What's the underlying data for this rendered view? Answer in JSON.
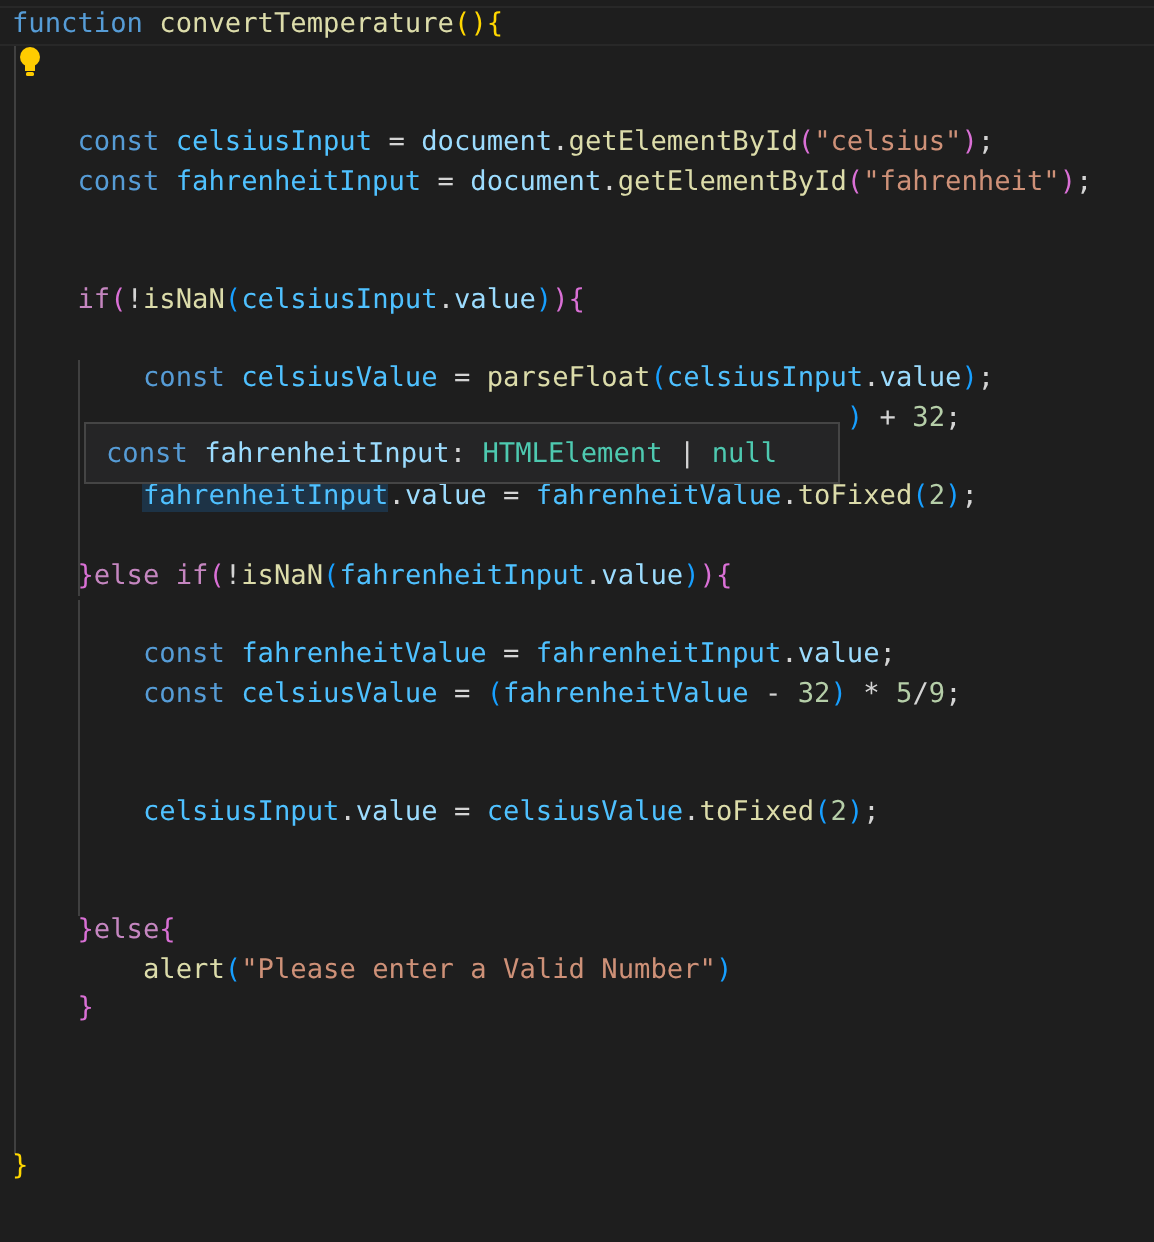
{
  "code_action_lightbulb": true,
  "tooltip": [
    {
      "text": "const ",
      "kind": "keyword"
    },
    {
      "text": "fahrenheitInput",
      "kind": "variable"
    },
    {
      "text": ": ",
      "kind": "plain"
    },
    {
      "text": "HTMLElement",
      "kind": "type"
    },
    {
      "text": " | ",
      "kind": "plain"
    },
    {
      "text": "null",
      "kind": "type"
    }
  ],
  "lines": [
    {
      "current": true,
      "tokens": [
        {
          "text": "function ",
          "kind": "keyword"
        },
        {
          "text": "convertTemperature",
          "kind": "function"
        },
        {
          "text": "(",
          "kind": "bracket1"
        },
        {
          "text": ")",
          "kind": "bracket1"
        },
        {
          "text": "{",
          "kind": "bracket1"
        }
      ]
    },
    {
      "current": false
    },
    {
      "current": false
    },
    {
      "current": false,
      "tokens": [
        {
          "text": "    const ",
          "kind": "keyword"
        },
        {
          "text": "celsiusInput",
          "kind": "constant"
        },
        {
          "text": " = ",
          "kind": "plain"
        },
        {
          "text": "document",
          "kind": "variable"
        },
        {
          "text": ".",
          "kind": "plain"
        },
        {
          "text": "getElementById",
          "kind": "function"
        },
        {
          "text": "(",
          "kind": "bracket2"
        },
        {
          "text": "\"celsius\"",
          "kind": "string"
        },
        {
          "text": ")",
          "kind": "bracket2"
        },
        {
          "text": ";",
          "kind": "plain"
        }
      ]
    },
    {
      "current": false,
      "tokens": [
        {
          "text": "    const ",
          "kind": "keyword"
        },
        {
          "text": "fahrenheitInput",
          "kind": "constant"
        },
        {
          "text": " = ",
          "kind": "plain"
        },
        {
          "text": "document",
          "kind": "variable"
        },
        {
          "text": ".",
          "kind": "plain"
        },
        {
          "text": "getElementById",
          "kind": "function"
        },
        {
          "text": "(",
          "kind": "bracket2"
        },
        {
          "text": "\"fahrenheit\"",
          "kind": "string"
        },
        {
          "text": ")",
          "kind": "bracket2"
        },
        {
          "text": ";",
          "kind": "plain"
        }
      ]
    },
    {
      "current": false
    },
    {
      "current": false
    },
    {
      "current": false,
      "tokens": [
        {
          "text": "    if",
          "kind": "control"
        },
        {
          "text": "(",
          "kind": "bracket2"
        },
        {
          "text": "!",
          "kind": "plain"
        },
        {
          "text": "isNaN",
          "kind": "function"
        },
        {
          "text": "(",
          "kind": "bracket3"
        },
        {
          "text": "celsiusInput",
          "kind": "constant"
        },
        {
          "text": ".",
          "kind": "plain"
        },
        {
          "text": "value",
          "kind": "variable"
        },
        {
          "text": ")",
          "kind": "bracket3"
        },
        {
          "text": ")",
          "kind": "bracket2"
        },
        {
          "text": "{",
          "kind": "bracket2"
        }
      ]
    },
    {
      "current": false
    },
    {
      "current": false,
      "tokens": [
        {
          "text": "        const ",
          "kind": "keyword"
        },
        {
          "text": "celsiusValue",
          "kind": "constant"
        },
        {
          "text": " = ",
          "kind": "plain"
        },
        {
          "text": "parseFloat",
          "kind": "function"
        },
        {
          "text": "(",
          "kind": "bracket3"
        },
        {
          "text": "celsiusInput",
          "kind": "constant"
        },
        {
          "text": ".",
          "kind": "plain"
        },
        {
          "text": "value",
          "kind": "variable"
        },
        {
          "text": ")",
          "kind": "bracket3"
        },
        {
          "text": ";",
          "kind": "plain"
        }
      ]
    },
    {
      "current": false,
      "tokens": [
        {
          "text": "                                                   )",
          "kind": "bracket3"
        },
        {
          "text": " + ",
          "kind": "plain"
        },
        {
          "text": "32",
          "kind": "number"
        },
        {
          "text": ";",
          "kind": "plain"
        }
      ]
    },
    {
      "current": false
    },
    {
      "current": false,
      "tokens": [
        {
          "text": "        fahrenheitInput",
          "kind": "match"
        },
        {
          "text": ".",
          "kind": "plain"
        },
        {
          "text": "value",
          "kind": "variable"
        },
        {
          "text": " = ",
          "kind": "plain"
        },
        {
          "text": "fahrenheitValue",
          "kind": "constant"
        },
        {
          "text": ".",
          "kind": "plain"
        },
        {
          "text": "toFixed",
          "kind": "function"
        },
        {
          "text": "(",
          "kind": "bracket3"
        },
        {
          "text": "2",
          "kind": "number"
        },
        {
          "text": ")",
          "kind": "bracket3"
        },
        {
          "text": ";",
          "kind": "plain"
        }
      ]
    },
    {
      "current": false
    },
    {
      "current": false,
      "tokens": [
        {
          "text": "    }",
          "kind": "bracket2"
        },
        {
          "text": "else ",
          "kind": "control"
        },
        {
          "text": "if",
          "kind": "control"
        },
        {
          "text": "(",
          "kind": "bracket2"
        },
        {
          "text": "!",
          "kind": "plain"
        },
        {
          "text": "isNaN",
          "kind": "function"
        },
        {
          "text": "(",
          "kind": "bracket3"
        },
        {
          "text": "fahrenheitInput",
          "kind": "constant"
        },
        {
          "text": ".",
          "kind": "plain"
        },
        {
          "text": "value",
          "kind": "variable"
        },
        {
          "text": ")",
          "kind": "bracket3"
        },
        {
          "text": ")",
          "kind": "bracket2"
        },
        {
          "text": "{",
          "kind": "bracket2"
        }
      ]
    },
    {
      "current": false
    },
    {
      "current": false,
      "tokens": [
        {
          "text": "        const ",
          "kind": "keyword"
        },
        {
          "text": "fahrenheitValue",
          "kind": "constant"
        },
        {
          "text": " = ",
          "kind": "plain"
        },
        {
          "text": "fahrenheitInput",
          "kind": "constant"
        },
        {
          "text": ".",
          "kind": "plain"
        },
        {
          "text": "value",
          "kind": "variable"
        },
        {
          "text": ";",
          "kind": "plain"
        }
      ]
    },
    {
      "current": false,
      "tokens": [
        {
          "text": "        const ",
          "kind": "keyword"
        },
        {
          "text": "celsiusValue",
          "kind": "constant"
        },
        {
          "text": " = ",
          "kind": "plain"
        },
        {
          "text": "(",
          "kind": "bracket3"
        },
        {
          "text": "fahrenheitValue",
          "kind": "constant"
        },
        {
          "text": " - ",
          "kind": "plain"
        },
        {
          "text": "32",
          "kind": "number"
        },
        {
          "text": ")",
          "kind": "bracket3"
        },
        {
          "text": " * ",
          "kind": "plain"
        },
        {
          "text": "5",
          "kind": "number"
        },
        {
          "text": "/",
          "kind": "plain"
        },
        {
          "text": "9",
          "kind": "number"
        },
        {
          "text": ";",
          "kind": "plain"
        }
      ]
    },
    {
      "current": false
    },
    {
      "current": false
    },
    {
      "current": false,
      "tokens": [
        {
          "text": "        celsiusInput",
          "kind": "constant"
        },
        {
          "text": ".",
          "kind": "plain"
        },
        {
          "text": "value",
          "kind": "variable"
        },
        {
          "text": " = ",
          "kind": "plain"
        },
        {
          "text": "celsiusValue",
          "kind": "constant"
        },
        {
          "text": ".",
          "kind": "plain"
        },
        {
          "text": "toFixed",
          "kind": "function"
        },
        {
          "text": "(",
          "kind": "bracket3"
        },
        {
          "text": "2",
          "kind": "number"
        },
        {
          "text": ")",
          "kind": "bracket3"
        },
        {
          "text": ";",
          "kind": "plain"
        }
      ]
    },
    {
      "current": false
    },
    {
      "current": false
    },
    {
      "current": false,
      "tokens": [
        {
          "text": "    }",
          "kind": "bracket2"
        },
        {
          "text": "else",
          "kind": "control"
        },
        {
          "text": "{",
          "kind": "bracket2"
        }
      ]
    },
    {
      "current": false,
      "tokens": [
        {
          "text": "        alert",
          "kind": "function"
        },
        {
          "text": "(",
          "kind": "bracket3"
        },
        {
          "text": "\"Please enter a Valid Number\"",
          "kind": "string"
        },
        {
          "text": ")",
          "kind": "bracket3"
        }
      ]
    },
    {
      "current": false,
      "tokens": [
        {
          "text": "    }",
          "kind": "bracket2"
        }
      ]
    },
    {
      "current": false
    },
    {
      "current": false
    },
    {
      "current": false
    },
    {
      "current": false,
      "tokens": [
        {
          "text": "}",
          "kind": "bracket1"
        }
      ]
    }
  ]
}
